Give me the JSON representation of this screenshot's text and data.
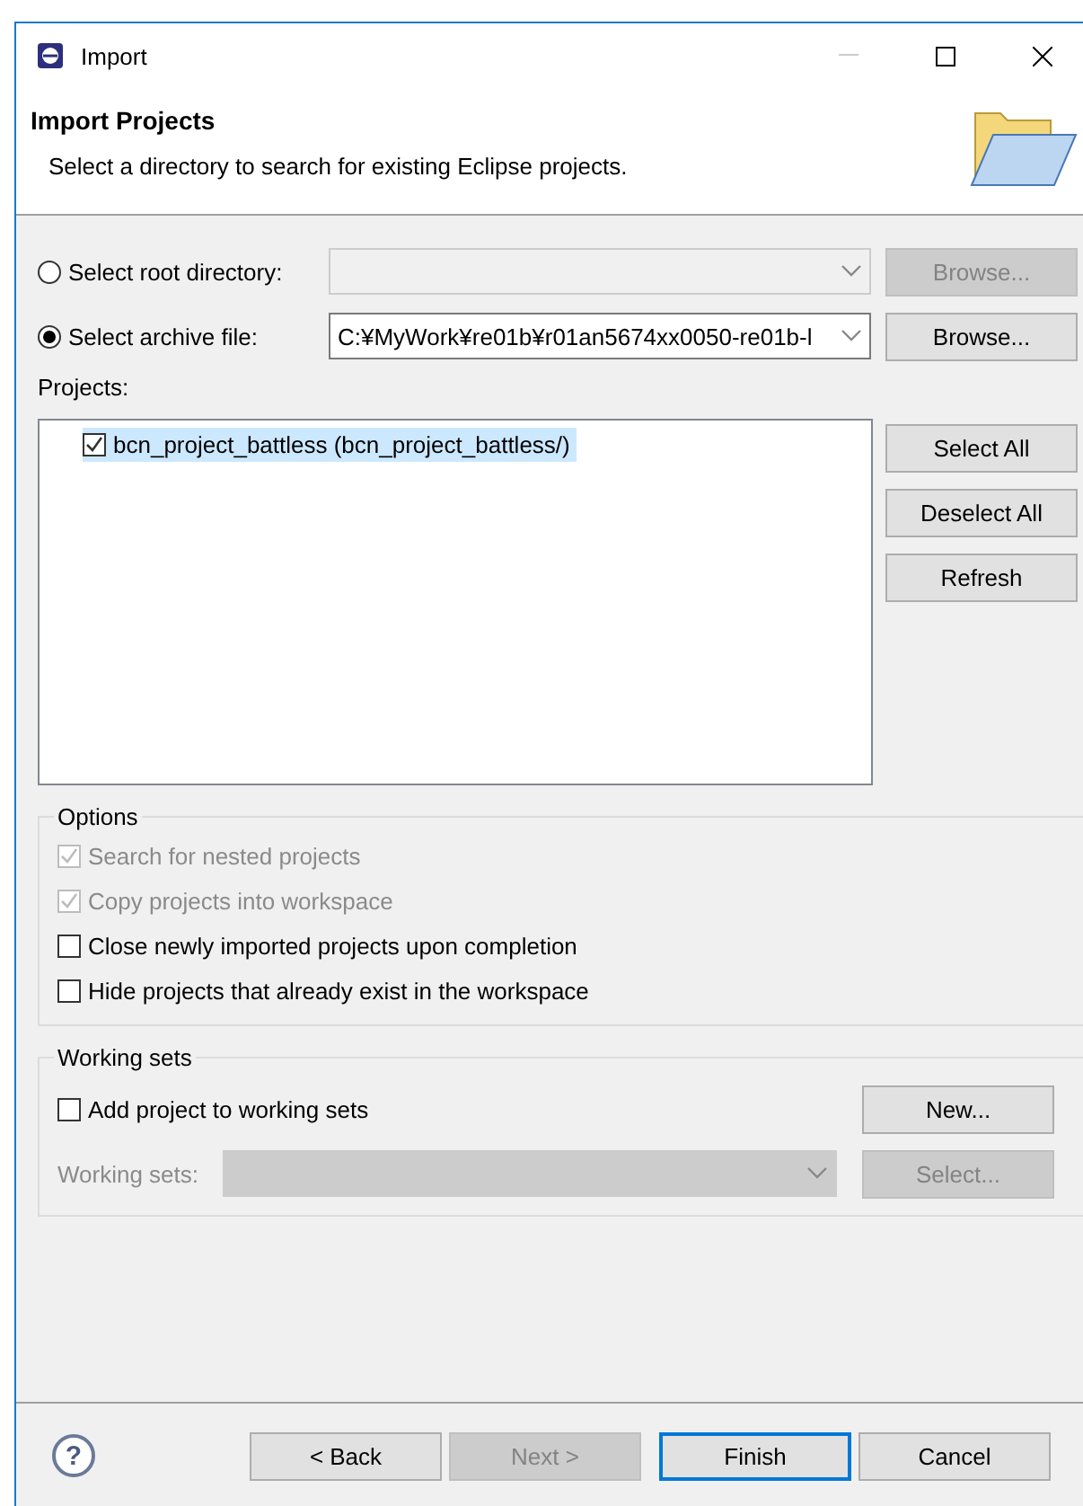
{
  "window": {
    "title": "Import"
  },
  "header": {
    "title": "Import Projects",
    "description": "Select a directory to search for existing Eclipse projects."
  },
  "source": [
    {
      "label": "Select root directory:",
      "selected": false,
      "disabled": true,
      "button": "Browse..."
    },
    {
      "label": "Select archive file:",
      "selected": true,
      "value": "C:¥MyWork¥re01b¥r01an5674xx0050-re01b-l",
      "disabled": false,
      "button": "Browse..."
    }
  ],
  "projects": {
    "label": "Projects:",
    "items": [
      {
        "name": "bcn_project_battless (bcn_project_battless/)",
        "checked": true,
        "selected": true
      }
    ],
    "buttons": [
      "Select All",
      "Deselect All",
      "Refresh"
    ]
  },
  "options": {
    "title": "Options",
    "items": [
      {
        "label": "Search for nested projects",
        "checked": true,
        "disabled": true
      },
      {
        "label": "Copy projects into workspace",
        "checked": true,
        "disabled": true
      },
      {
        "label": "Close newly imported projects upon completion",
        "checked": false,
        "disabled": false
      },
      {
        "label": "Hide projects that already exist in the workspace",
        "checked": false,
        "disabled": false
      }
    ]
  },
  "working_sets": {
    "title": "Working sets",
    "add": {
      "label": "Add project to working sets",
      "checked": false
    },
    "new_button": "New...",
    "field_label": "Working sets:",
    "select_button": "Select..."
  },
  "footer": {
    "help": "?",
    "buttons": [
      {
        "label": "< Back",
        "disabled": false,
        "default": false
      },
      {
        "label": "Next >",
        "disabled": true,
        "default": false
      },
      {
        "label": "Finish",
        "disabled": false,
        "default": true
      },
      {
        "label": "Cancel",
        "disabled": false,
        "default": false
      }
    ]
  }
}
